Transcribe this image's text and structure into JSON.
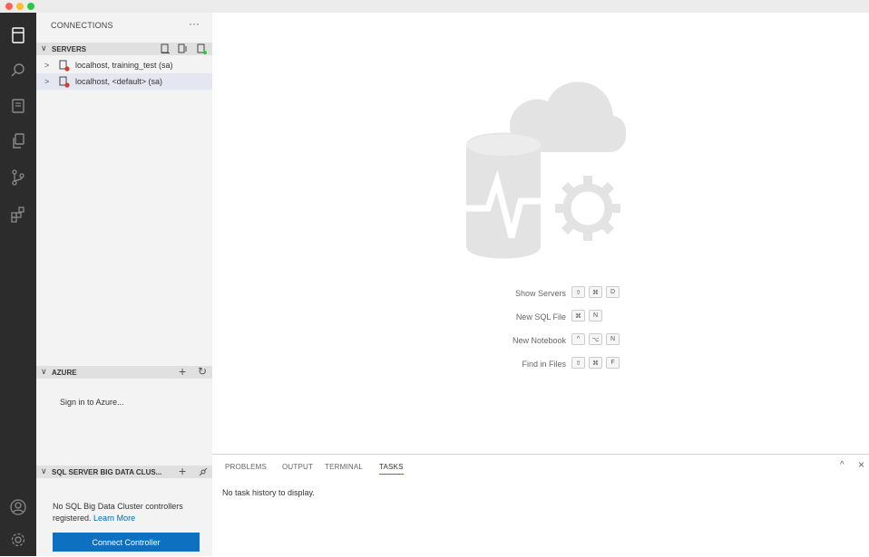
{
  "colors": {
    "activity_bar": "#2c2c2c",
    "sidebar": "#f3f3f3",
    "accent": "#0e70c0",
    "error_badge": "#d13d2f",
    "traffic_red": "#fe5f57",
    "traffic_yellow": "#febc2e",
    "traffic_green": "#28c840"
  },
  "activity_bar": {
    "items": [
      "servers-icon",
      "search-icon",
      "notebook-icon",
      "explorer-icon",
      "source-control-icon",
      "extensions-icon"
    ],
    "bottom": [
      "account-icon",
      "settings-gear-icon"
    ]
  },
  "sidebar": {
    "title": "CONNECTIONS",
    "more": "···",
    "servers": {
      "header": "SERVERS",
      "items": [
        {
          "label": "localhost, training_test (sa)"
        },
        {
          "label": "localhost, <default> (sa)"
        }
      ]
    },
    "azure": {
      "header": "AZURE",
      "add": "+",
      "refresh": "↻",
      "signin": "Sign in to Azure..."
    },
    "bdc": {
      "header": "SQL SERVER BIG DATA CLUS...",
      "add": "+",
      "message": "No SQL Big Data Cluster controllers registered.",
      "learn_more": "Learn More",
      "button": "Connect Controller"
    }
  },
  "editor": {
    "shortcuts": [
      {
        "label": "Show Servers",
        "keys": [
          "⇧",
          "⌘",
          "D"
        ]
      },
      {
        "label": "New SQL File",
        "keys": [
          "⌘",
          "N"
        ]
      },
      {
        "label": "New Notebook",
        "keys": [
          "^",
          "⌥",
          "N"
        ]
      },
      {
        "label": "Find in Files",
        "keys": [
          "⇧",
          "⌘",
          "F"
        ]
      }
    ]
  },
  "panel": {
    "tabs": [
      {
        "label": "PROBLEMS"
      },
      {
        "label": "OUTPUT"
      },
      {
        "label": "TERMINAL"
      },
      {
        "label": "TASKS"
      }
    ],
    "active_tab": "TASKS",
    "maximize": "^",
    "close": "×",
    "message": "No task history to display."
  }
}
